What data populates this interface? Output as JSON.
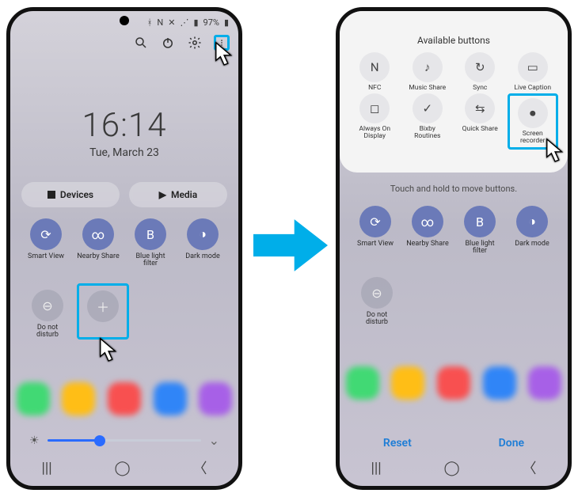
{
  "colors": {
    "accent": "#00aee9",
    "toggle_on": "#6b7ab8",
    "link": "#1e7dd6"
  },
  "status": {
    "battery_pct": "97%",
    "nfc_glyph": "N"
  },
  "left": {
    "time": "16:14",
    "date": "Tue, March 23",
    "devices_label": "Devices",
    "media_label": "Media",
    "tiles": [
      {
        "id": "smart-view",
        "label": "Smart View",
        "on": true,
        "glyph": "⟳"
      },
      {
        "id": "nearby-share",
        "label": "Nearby Share",
        "on": true,
        "glyph": "∞"
      },
      {
        "id": "blue-light",
        "label": "Blue light\nfilter",
        "on": true,
        "glyph": "B"
      },
      {
        "id": "dark-mode",
        "label": "Dark mode",
        "on": true,
        "glyph": "◑"
      }
    ],
    "tiles_row2": [
      {
        "id": "dnd",
        "label": "Do not\ndisturb",
        "on": false,
        "glyph": "⊖"
      },
      {
        "id": "add",
        "label": "",
        "on": false,
        "glyph": "＋"
      }
    ],
    "brightness_pct": 34
  },
  "right": {
    "panel_title": "Available buttons",
    "hint": "Touch and hold to move buttons.",
    "reset_label": "Reset",
    "done_label": "Done",
    "available": [
      {
        "id": "nfc",
        "label": "NFC",
        "glyph": "N"
      },
      {
        "id": "music-share",
        "label": "Music Share",
        "glyph": "♪"
      },
      {
        "id": "sync",
        "label": "Sync",
        "glyph": "↻"
      },
      {
        "id": "live-caption",
        "label": "Live Caption",
        "glyph": "▭"
      },
      {
        "id": "aod",
        "label": "Always On\nDisplay",
        "glyph": "◻"
      },
      {
        "id": "bixby",
        "label": "Bixby\nRoutines",
        "glyph": "✓"
      },
      {
        "id": "quick-share",
        "label": "Quick Share",
        "glyph": "⇆"
      },
      {
        "id": "screen-record",
        "label": "Screen\nrecorder",
        "glyph": "⏺"
      }
    ],
    "tiles": [
      {
        "id": "smart-view",
        "label": "Smart View",
        "on": true,
        "glyph": "⟳"
      },
      {
        "id": "nearby-share",
        "label": "Nearby Share",
        "on": true,
        "glyph": "∞"
      },
      {
        "id": "blue-light",
        "label": "Blue light\nfilter",
        "on": true,
        "glyph": "B"
      },
      {
        "id": "dark-mode",
        "label": "Dark mode",
        "on": true,
        "glyph": "◑"
      }
    ],
    "tiles_row2": [
      {
        "id": "dnd",
        "label": "Do not\ndisturb",
        "on": false,
        "glyph": "⊖"
      }
    ]
  }
}
